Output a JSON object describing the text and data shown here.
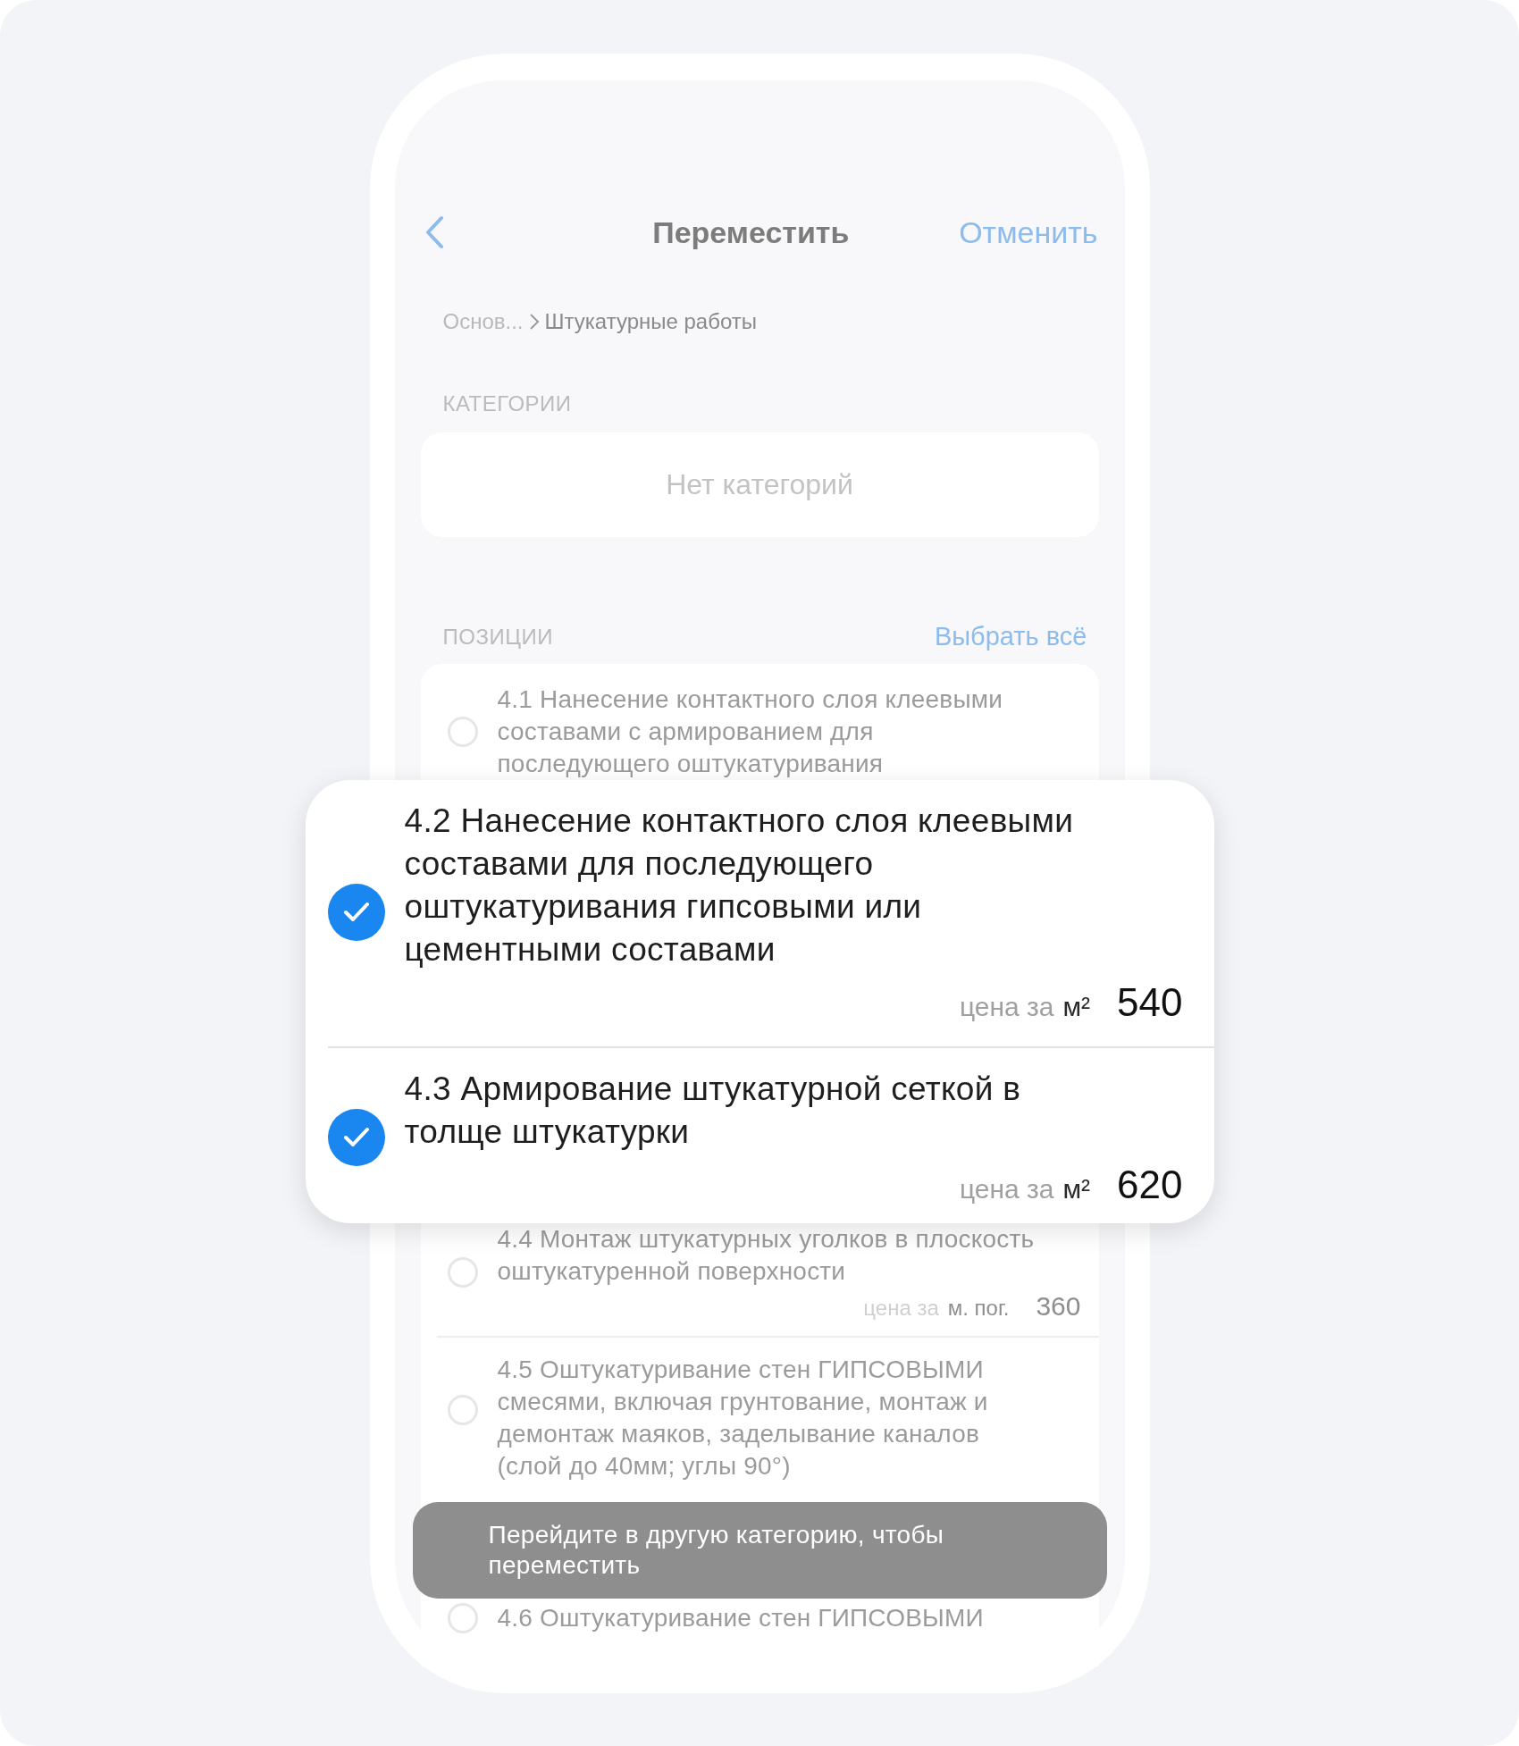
{
  "header": {
    "title": "Переместить",
    "cancel": "Отменить"
  },
  "breadcrumb": {
    "parent": "Основ...",
    "current": "Штукатурные работы"
  },
  "categories": {
    "heading": "КАТЕГОРИИ",
    "empty": "Нет категорий"
  },
  "positions": {
    "heading": "ПОЗИЦИИ",
    "select_all": "Выбрать всё",
    "rows": [
      {
        "kind": "position",
        "title": "4.1 Нанесение контактного слоя клеевыми составами с армированием для последующего оштукатуривания",
        "checked": false,
        "lifted": false
      },
      {
        "kind": "position",
        "title": "4.2 Нанесение контактного слоя клеевыми составами для последующего оштукатуривания гипсовыми или цементными составами",
        "checked": true,
        "lifted": true,
        "price": {
          "label": "цена за",
          "unit": "м²",
          "value": "540"
        }
      },
      {
        "kind": "position",
        "title": "4.3 Армирование штукатурной сеткой в толще штукатурки",
        "checked": true,
        "lifted": true,
        "price": {
          "label": "цена за",
          "unit": "м²",
          "value": "620"
        }
      },
      {
        "kind": "position",
        "title": "4.4 Монтаж штукатурных уголков в плоскость оштукатуренной поверхности",
        "checked": false,
        "lifted": false,
        "price": {
          "label": "цена за",
          "unit": "м. пог.",
          "value": "360"
        }
      },
      {
        "kind": "position",
        "title": "4.5 Оштукатуривание стен ГИПСОВЫМИ смесями, включая грунтование, монтаж и демонтаж маяков, заделывание каналов (слой до 40мм; углы 90°)",
        "checked": false,
        "lifted": false
      },
      {
        "kind": "toast",
        "text": "Перейдите в другую категорию, чтобы переместить"
      },
      {
        "kind": "position",
        "title": "4.6 Оштукатуривание стен ГИПСОВЫМИ",
        "checked": false,
        "lifted": false
      }
    ]
  }
}
